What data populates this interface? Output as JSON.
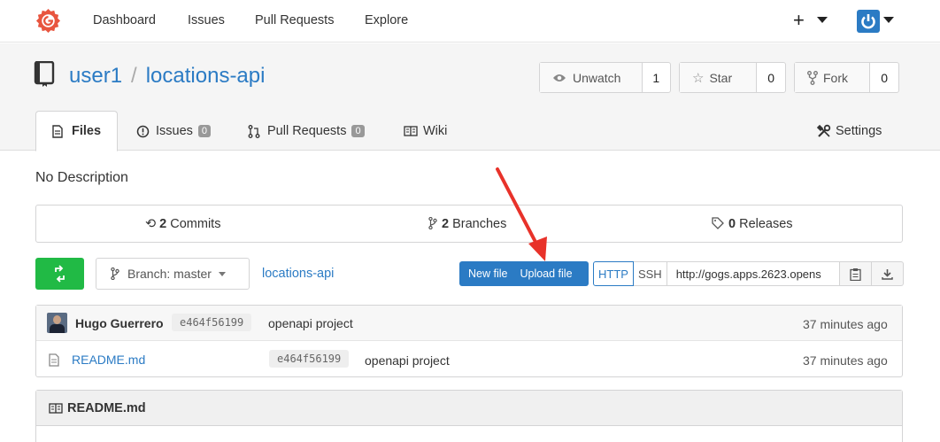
{
  "nav": {
    "items": [
      "Dashboard",
      "Issues",
      "Pull Requests",
      "Explore"
    ],
    "plus_label": "+"
  },
  "repo": {
    "owner": "user1",
    "separator": "/",
    "name": "locations-api",
    "watch": {
      "label": "Unwatch",
      "count": "1"
    },
    "star": {
      "label": "Star",
      "count": "0"
    },
    "fork": {
      "label": "Fork",
      "count": "0"
    }
  },
  "tabs": [
    {
      "label": "Files"
    },
    {
      "label": "Issues",
      "count": "0"
    },
    {
      "label": "Pull Requests",
      "count": "0"
    },
    {
      "label": "Wiki"
    },
    {
      "label": "Settings"
    }
  ],
  "description": "No Description",
  "stats": {
    "commits": {
      "count": "2",
      "label": "Commits"
    },
    "branches": {
      "count": "2",
      "label": "Branches"
    },
    "releases": {
      "count": "0",
      "label": "Releases"
    }
  },
  "toolbar": {
    "branch_label": "Branch: master",
    "breadcrumb": "locations-api",
    "new_file": "New file",
    "upload_file": "Upload file",
    "http": "HTTP",
    "ssh": "SSH",
    "clone_url": "http://gogs.apps.2623.opens"
  },
  "latest_commit": {
    "author": "Hugo Guerrero",
    "sha": "e464f56199",
    "message": "openapi project",
    "time": "37 minutes ago"
  },
  "files": [
    {
      "name": "README.md",
      "sha": "e464f56199",
      "message": "openapi project",
      "time": "37 minutes ago"
    }
  ],
  "readme": {
    "title": "README.md"
  },
  "colors": {
    "accent": "#2b7bc4",
    "success": "#21ba45",
    "annotation": "#e8322a"
  },
  "icons": [
    "gogs-logo-icon",
    "repo-icon",
    "eye-icon",
    "star-icon",
    "fork-icon",
    "file-icon",
    "issue-icon",
    "pull-request-icon",
    "wiki-icon",
    "settings-icon",
    "history-icon",
    "branch-icon",
    "tag-icon",
    "sync-icon",
    "clipboard-icon",
    "download-icon",
    "book-icon"
  ]
}
